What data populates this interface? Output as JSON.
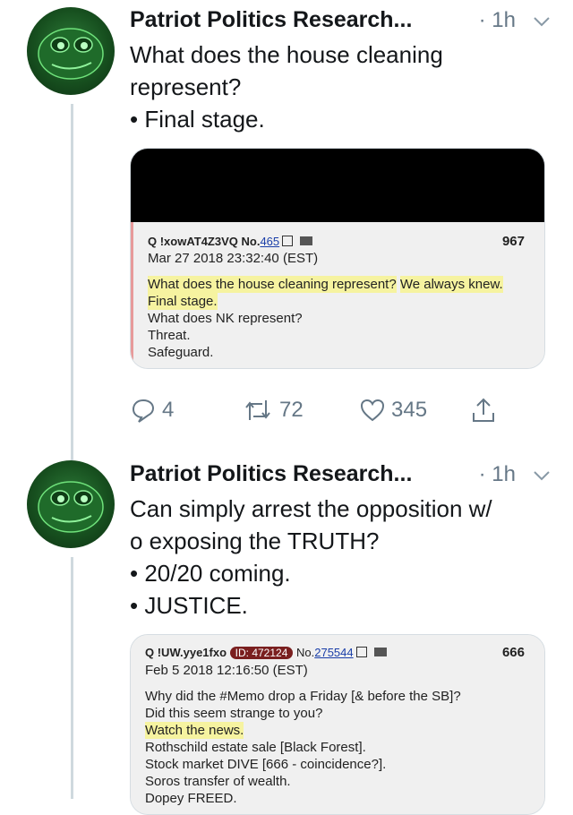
{
  "tweets": [
    {
      "author": "Patriot Politics Research...",
      "time": "· 1h",
      "lines": [
        "What does the house cleaning",
        "represent?",
        "• Final stage."
      ],
      "card": {
        "meta": "Q !xowAT4Z3VQ No.",
        "post_link": "465",
        "number": "967",
        "date": "Mar 27 2018 23:32:40 (EST)",
        "body": [
          {
            "text": "What does the house cleaning represent?",
            "highlight": true
          },
          {
            "text": "We always knew.",
            "highlight": true
          },
          {
            "text": "Final stage.",
            "highlight": true
          },
          {
            "text": "What does NK represent?",
            "highlight": false
          },
          {
            "text": "Threat.",
            "highlight": false
          },
          {
            "text": "Safeguard.",
            "highlight": false
          }
        ]
      },
      "actions": {
        "replies": "4",
        "retweets": "72",
        "likes": "345"
      }
    },
    {
      "author": "Patriot Politics Research...",
      "time": "· 1h",
      "lines": [
        "Can simply arrest the opposition w/",
        "o exposing the TRUTH?",
        "• 20/20 coming.",
        "• JUSTICE."
      ],
      "card": {
        "meta": "Q !UW.yye1fxo",
        "id_badge": "ID: 472124",
        "meta_no": "No.",
        "post_link": "275544",
        "number": "666",
        "date": "Feb 5 2018 12:16:50 (EST)",
        "body": [
          {
            "text": "Why did the #Memo drop a Friday [& before the SB]?",
            "highlight": false
          },
          {
            "text": "Did this seem strange to you?",
            "highlight": false
          },
          {
            "text": "Watch the news.",
            "highlight": true
          },
          {
            "text": "Rothschild estate sale [Black Forest].",
            "highlight": false
          },
          {
            "text": "Stock market DIVE [666 - coincidence?].",
            "highlight": false
          },
          {
            "text": "Soros transfer of wealth.",
            "highlight": false
          },
          {
            "text": "Dopey FREED.",
            "highlight": false
          }
        ]
      }
    }
  ],
  "colors": {
    "accent": "#1da1f2",
    "muted": "#657786",
    "highlight": "#f6f3a0",
    "thread_line": "#cfd9de"
  }
}
